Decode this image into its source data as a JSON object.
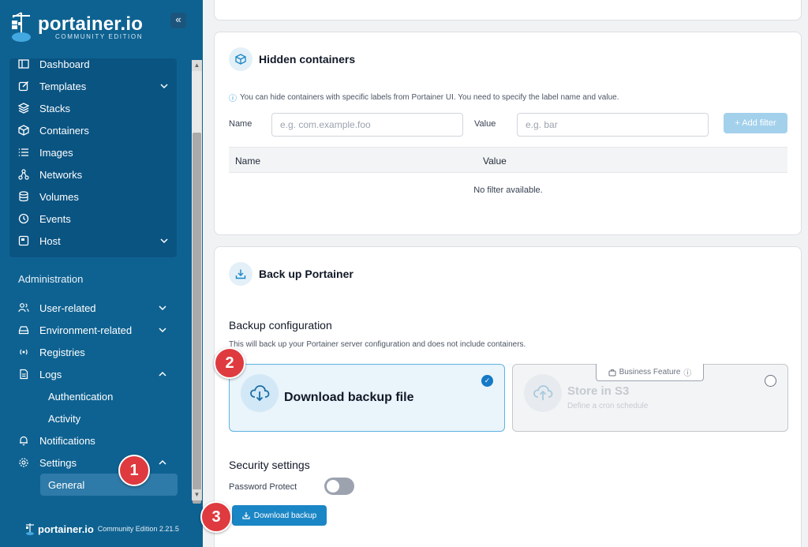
{
  "brand": {
    "name": "portainer.io",
    "edition": "COMMUNITY EDITION",
    "footer_name": "portainer.io",
    "footer_version": "Community Edition  2.21.5",
    "collapse_icon": "«"
  },
  "sidebar": {
    "env_items": [
      {
        "label": "Dashboard",
        "icon": "dashboard-icon"
      },
      {
        "label": "Templates",
        "icon": "edit-icon"
      },
      {
        "label": "Stacks",
        "icon": "layers-icon"
      },
      {
        "label": "Containers",
        "icon": "box-icon"
      },
      {
        "label": "Images",
        "icon": "list-icon"
      },
      {
        "label": "Networks",
        "icon": "network-icon"
      },
      {
        "label": "Volumes",
        "icon": "database-icon"
      },
      {
        "label": "Events",
        "icon": "clock-icon"
      },
      {
        "label": "Host",
        "icon": "server-icon"
      }
    ],
    "admin_title": "Administration",
    "admin_items": [
      {
        "label": "User-related",
        "icon": "users-icon"
      },
      {
        "label": "Environment-related",
        "icon": "hdd-icon"
      },
      {
        "label": "Registries",
        "icon": "radio-icon"
      },
      {
        "label": "Logs",
        "icon": "file-icon"
      },
      {
        "label": "Notifications",
        "icon": "bell-icon"
      },
      {
        "label": "Settings",
        "icon": "gear-icon"
      }
    ],
    "log_subitems": [
      "Authentication",
      "Activity"
    ],
    "settings_subitems": [
      "General"
    ]
  },
  "steps": [
    "1",
    "2",
    "3"
  ],
  "hidden_containers": {
    "title": "Hidden containers",
    "info": "You can hide containers with specific labels from Portainer UI. You need to specify the label name and value.",
    "name_label": "Name",
    "name_placeholder": "e.g. com.example.foo",
    "value_label": "Value",
    "value_placeholder": "e.g. bar",
    "add_filter": "+ Add filter",
    "columns": [
      "Name",
      "Value"
    ],
    "empty": "No filter available."
  },
  "backup": {
    "title": "Back up Portainer",
    "config_heading": "Backup configuration",
    "config_desc": "This will back up your Portainer server configuration and does not include containers.",
    "download_option": "Download backup file",
    "s3_option": "Store in S3",
    "s3_sub": "Define a cron schedule",
    "business_badge": "Business Feature",
    "security_heading": "Security settings",
    "password_label": "Password Protect",
    "password_protect": false,
    "download_button": "Download backup"
  }
}
